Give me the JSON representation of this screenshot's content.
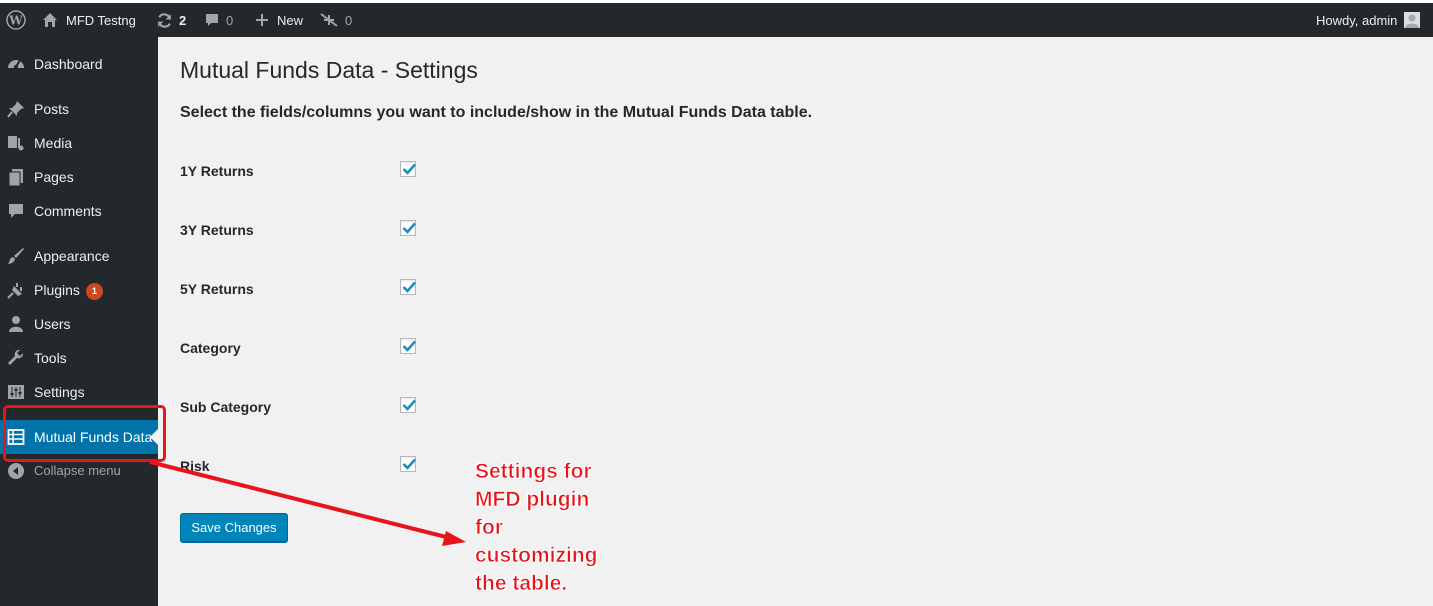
{
  "admin_bar": {
    "site_name": "MFD Testng",
    "updates_count": "2",
    "comments_count": "0",
    "new_label": "New",
    "plugin_count": "0",
    "greeting": "Howdy, admin"
  },
  "sidebar": {
    "items": [
      {
        "label": "Dashboard",
        "icon": "dashboard-icon"
      },
      {
        "label": "Posts",
        "icon": "pin-icon"
      },
      {
        "label": "Media",
        "icon": "media-icon"
      },
      {
        "label": "Pages",
        "icon": "pages-icon"
      },
      {
        "label": "Comments",
        "icon": "comment-icon"
      },
      {
        "label": "Appearance",
        "icon": "brush-icon"
      },
      {
        "label": "Plugins",
        "icon": "plugin-icon",
        "badge": "1"
      },
      {
        "label": "Users",
        "icon": "user-icon"
      },
      {
        "label": "Tools",
        "icon": "wrench-icon"
      },
      {
        "label": "Settings",
        "icon": "sliders-icon"
      },
      {
        "label": "Mutual Funds Data",
        "icon": "table-icon",
        "current": true
      },
      {
        "label": "Collapse menu",
        "icon": "collapse-icon"
      }
    ]
  },
  "main": {
    "title": "Mutual Funds Data - Settings",
    "subtitle": "Select the fields/columns you want to include/show in the Mutual Funds Data table.",
    "fields": [
      {
        "label": "1Y Returns",
        "checked": true
      },
      {
        "label": "3Y Returns",
        "checked": true
      },
      {
        "label": "5Y Returns",
        "checked": true
      },
      {
        "label": "Category",
        "checked": true
      },
      {
        "label": "Sub Category",
        "checked": true
      },
      {
        "label": "Risk",
        "checked": true
      }
    ],
    "save_label": "Save Changes"
  },
  "annotation": {
    "lines": [
      "Settings for",
      "MFD plugin",
      "for",
      "customizing",
      "the table."
    ]
  },
  "colors": {
    "admin_bar_bg": "#23282d",
    "menu_current": "#0073aa",
    "button_primary": "#0085ba",
    "badge": "#ca4a1f",
    "annotation_red": "#e8141b",
    "content_bg": "#f1f1f1"
  }
}
